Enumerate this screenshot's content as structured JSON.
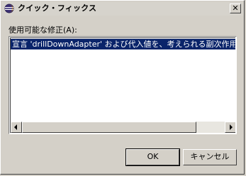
{
  "window": {
    "title": "クイック・フィックス"
  },
  "list": {
    "label": "使用可能な修正(A):",
    "items": [
      "宣言 'drillDownAdapter' および代入値を、考えられる副次作用なし"
    ],
    "selected_index": 0
  },
  "buttons": {
    "ok": "OK",
    "cancel": "キャンセル"
  }
}
